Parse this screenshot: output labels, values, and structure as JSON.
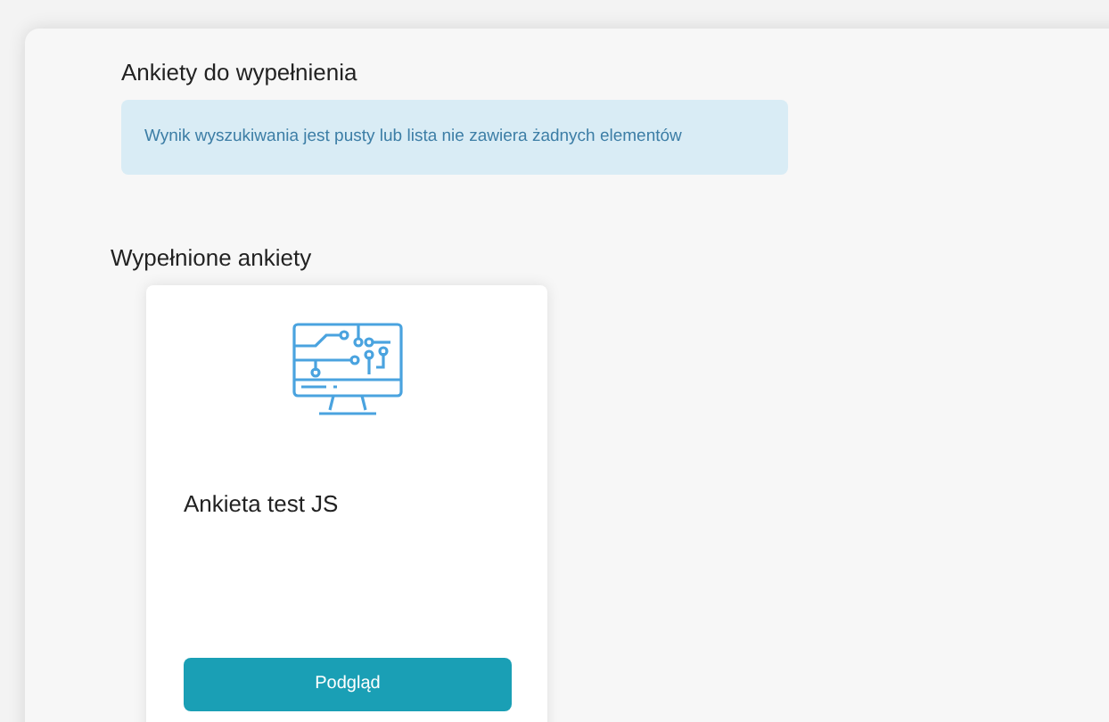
{
  "sections": [
    {
      "title": "Ankiety do wypełnienia",
      "empty_message": "Wynik wyszukiwania jest pusty lub lista nie zawiera żadnych elementów"
    },
    {
      "title": "Wypełnione ankiety",
      "cards": [
        {
          "title": "Ankieta test JS",
          "button": "Podgląd"
        }
      ]
    }
  ]
}
